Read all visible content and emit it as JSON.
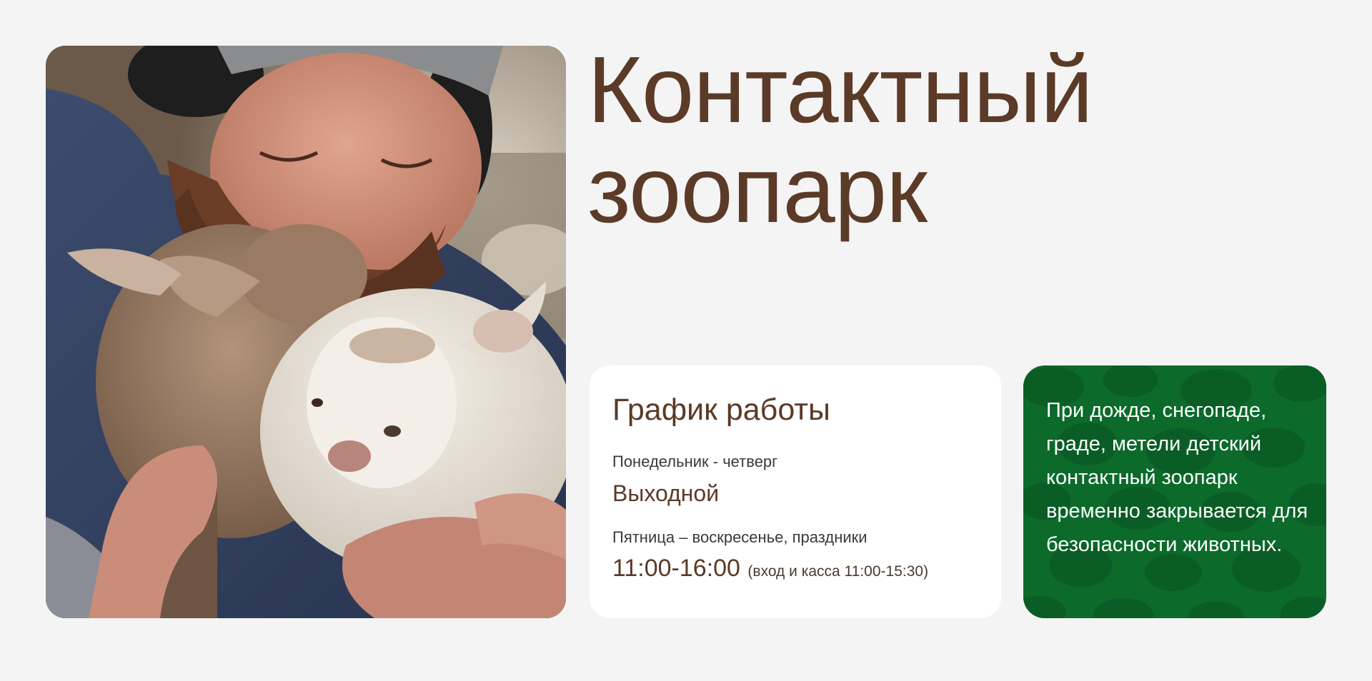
{
  "hero": {
    "photo_alt": "Мужчина обнимает двух козлят",
    "title_line1": "Контактный",
    "title_line2": "зоопарк"
  },
  "schedule": {
    "title": "График работы",
    "weekdays_label": "Понедельник - четверг",
    "weekdays_value": "Выходной",
    "weekend_label": "Пятница – воскресенье, праздники",
    "weekend_hours": "11:00-16:00",
    "weekend_note": "(вход и касса 11:00-15:30)"
  },
  "notice": {
    "text": "При дожде, снегопаде, граде, метели детский контактный зоопарк временно закрывается для безопасности животных."
  },
  "colors": {
    "background": "#f4f4f4",
    "brown_text": "#5b3a27",
    "notice_green": "#0c6a2b",
    "card_white": "#ffffff"
  }
}
